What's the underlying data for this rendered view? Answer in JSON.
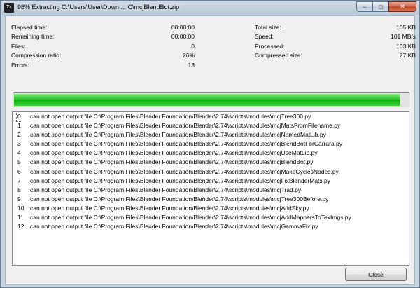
{
  "window": {
    "title": "98% Extracting C:\\Users\\User\\Down ... C\\mcjBlendBot.zip",
    "icon_text": "7z",
    "minimize_glyph": "‒",
    "maximize_glyph": "□",
    "close_glyph": "✕"
  },
  "stats_left": [
    {
      "label": "Elapsed time:",
      "value": "00:00:00"
    },
    {
      "label": "Remaining time:",
      "value": "00:00:00"
    },
    {
      "label": "Files:",
      "value": "0"
    },
    {
      "label": "Compression ratio:",
      "value": "26%"
    },
    {
      "label": "Errors:",
      "value": "13"
    }
  ],
  "stats_right": [
    {
      "label": "Total size:",
      "value": "105 KB"
    },
    {
      "label": "Speed:",
      "value": "101 MB/s"
    },
    {
      "label": "Processed:",
      "value": "103 KB"
    },
    {
      "label": "Compressed size:",
      "value": "27 KB"
    }
  ],
  "progress": {
    "percent": 98,
    "color": "#22c422"
  },
  "log": [
    {
      "index": "0",
      "message": "can not open output file C:\\Program Files\\Blender Foundation\\Blender\\2.74\\scripts\\modules\\mcjTree300.py"
    },
    {
      "index": "1",
      "message": "can not open output file C:\\Program Files\\Blender Foundation\\Blender\\2.74\\scripts\\modules\\mcjMatsFromFilename.py"
    },
    {
      "index": "2",
      "message": "can not open output file C:\\Program Files\\Blender Foundation\\Blender\\2.74\\scripts\\modules\\mcjNamedMatLib.py"
    },
    {
      "index": "3",
      "message": "can not open output file C:\\Program Files\\Blender Foundation\\Blender\\2.74\\scripts\\modules\\mcjBlendBotForCarrara.py"
    },
    {
      "index": "4",
      "message": "can not open output file C:\\Program Files\\Blender Foundation\\Blender\\2.74\\scripts\\modules\\mcjUseMatLib.py"
    },
    {
      "index": "5",
      "message": "can not open output file C:\\Program Files\\Blender Foundation\\Blender\\2.74\\scripts\\modules\\mcjBlendBot.py"
    },
    {
      "index": "6",
      "message": "can not open output file C:\\Program Files\\Blender Foundation\\Blender\\2.74\\scripts\\modules\\mcjMakeCyclesNodes.py"
    },
    {
      "index": "7",
      "message": "can not open output file C:\\Program Files\\Blender Foundation\\Blender\\2.74\\scripts\\modules\\mcjFixBlenderMats.py"
    },
    {
      "index": "8",
      "message": "can not open output file C:\\Program Files\\Blender Foundation\\Blender\\2.74\\scripts\\modules\\mcjTrad.py"
    },
    {
      "index": "9",
      "message": "can not open output file C:\\Program Files\\Blender Foundation\\Blender\\2.74\\scripts\\modules\\mcjTree300Before.py"
    },
    {
      "index": "10",
      "message": "can not open output file C:\\Program Files\\Blender Foundation\\Blender\\2.74\\scripts\\modules\\mcjAddSky.py"
    },
    {
      "index": "11",
      "message": "can not open output file C:\\Program Files\\Blender Foundation\\Blender\\2.74\\scripts\\modules\\mcjAddMappersToTexImgs.py"
    },
    {
      "index": "12",
      "message": "can not open output file C:\\Program Files\\Blender Foundation\\Blender\\2.74\\scripts\\modules\\mcjGammaFix.py"
    }
  ],
  "buttons": {
    "close_label": "Close"
  }
}
